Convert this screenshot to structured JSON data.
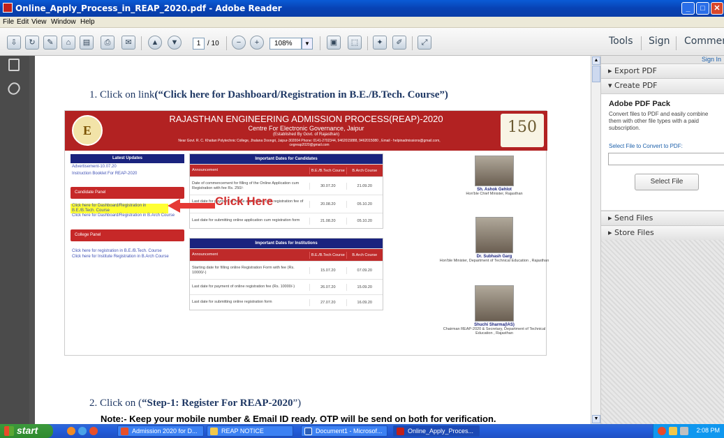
{
  "window": {
    "title": "Online_Apply_Process_in_REAP_2020.pdf - Adobe Reader",
    "minimize": "_",
    "maximize": "□",
    "close": "✕"
  },
  "menu": [
    "File",
    "Edit",
    "View",
    "Window",
    "Help"
  ],
  "toolbar": {
    "page_current": "1",
    "page_total": "/ 10",
    "zoom": "108%",
    "tools": "Tools",
    "sign": "Sign",
    "comment": "Comment"
  },
  "document": {
    "step1_prefix": "1.   Click on link",
    "step1_bold": "(“Click here for Dashboard/Registration in B.E./B.Tech. Course”)",
    "step2_prefix": "2.   Click on (",
    "step2_bold": "“Step-1: Register For REAP-2020",
    "step2_suffix": "”)",
    "note": "Note:-  Keep your mobile number & Email ID ready. OTP will be send on both for verification.",
    "click_here": "Click Here"
  },
  "reap": {
    "logo_letter": "E",
    "title": "RAJASTHAN ENGINEERING ADMISSION PROCESS(REAP)-2020",
    "subtitle": "Centre For Electronic Governance, Jaipur",
    "established": "(Established By Govt. of Rajasthan)",
    "address": "Near Govt. R. C. Khaitan Polytechnic College, Jhalana Doongri, Jaipur-302004 Phone: 0141-2702344, 9462015888, 9462015080 , Email - helpinadmissions@gmail.com, cegreap2020@gmail.com",
    "anniv": "150",
    "latest_updates": "Latest Updates",
    "updates": [
      "Advertisement-10.07.20",
      "Instruction Booklet For REAP-2020"
    ],
    "candidate_panel": "Candidate Panel",
    "candidate_links": [
      "Click here for Dashboard/Registration in B.E./B.Tech. Course",
      "Click here for Dashboard/Registration in B.Arch Course"
    ],
    "college_panel": "College Panel",
    "college_links": [
      "Click here for registration in B.E./B.Tech. Course",
      "Click here for Institute Registration in B.Arch Course"
    ],
    "candidates_table": {
      "title": "Important Dates for Candidates",
      "headers": [
        "Announcement",
        "B.E./B.Tech Course",
        "B.Arch Course"
      ],
      "rows": [
        [
          "Date of commencement for filling of the Online Application cum Registration with fee Rs. 250/-",
          "30.07.20",
          "21.09.20"
        ],
        [
          "Last date for payment of online application cum registration fee of Rs. 250/-",
          "20.08.20",
          "05.10.20"
        ],
        [
          "Last date for submitting online application cum registration form",
          "21.08.20",
          "05.10.20"
        ]
      ]
    },
    "institutions_table": {
      "title": "Important Dates for Institutions",
      "headers": [
        "Announcement",
        "B.E./B.Tech Course",
        "B.Arch Course"
      ],
      "rows": [
        [
          "Starting date for filling online Registration Form with fee (Rs. 10000/-)",
          "15.07.20",
          "07.09.20"
        ],
        [
          "Last date for payment of online registration fee (Rs. 10000/-)",
          "26.07.20",
          "15.09.20"
        ],
        [
          "Last date for submitting online registration form",
          "27.07.20",
          "16.09.20"
        ]
      ]
    },
    "people": [
      {
        "name": "Sh. Ashok Gehlot",
        "role": "Hon'ble Chief Minister, Rajasthan"
      },
      {
        "name": "Dr. Subhash Garg",
        "role": "Hon'ble Minister, Department of Technical Education , Rajasthan"
      },
      {
        "name": "Shuchi Sharma(IAS)",
        "role": "Chairman REAP-2020 & Secretary, Department of Technical Education , Rajasthan"
      }
    ]
  },
  "rightpane": {
    "sign_in": "Sign In",
    "export_pdf": "▸ Export PDF",
    "create_pdf": "▾ Create PDF",
    "pack_title": "Adobe PDF Pack",
    "pack_desc": "Convert files to PDF and easily combine them with other file types with a paid subscription.",
    "select_label": "Select File to Convert to PDF:",
    "select_button": "Select File",
    "send_files": "▸ Send Files",
    "store_files": "▸ Store Files"
  },
  "taskbar": {
    "start": "start",
    "tasks": [
      "Admission 2020 for D...",
      "REAP NOTICE",
      "Document1 - Microsof...",
      "Online_Apply_Proces..."
    ],
    "clock": "2:08 PM"
  }
}
